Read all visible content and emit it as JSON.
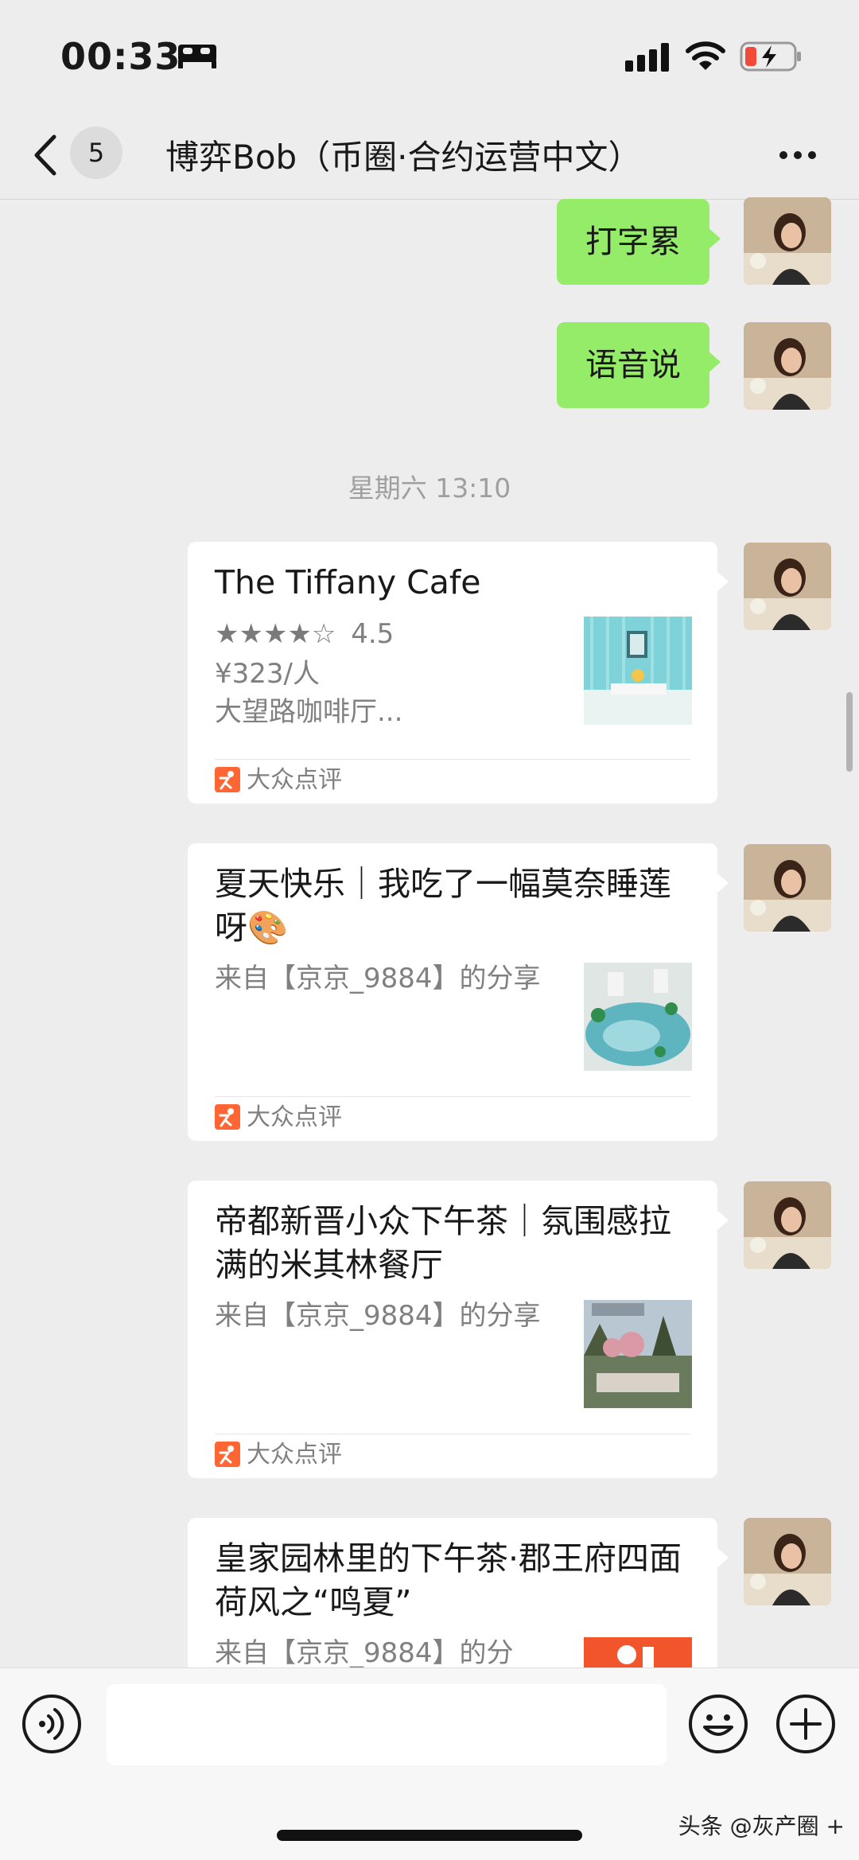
{
  "status_bar": {
    "time": "00:33"
  },
  "nav": {
    "unread_count": "5",
    "title": "博弈Bob（币圈·合约运营中文）"
  },
  "messages": {
    "text_1": "打字累",
    "text_2": "语音说",
    "timestamp": "星期六 13:10",
    "card_1": {
      "title": "The Tiffany Cafe",
      "rating": "4.5",
      "price": "¥323/人",
      "desc": "大望路咖啡厅...",
      "source": "大众点评"
    },
    "card_2": {
      "title": "夏天快乐｜我吃了一幅莫奈睡莲呀🎨",
      "subtitle": "来自【京京_9884】的分享",
      "source": "大众点评"
    },
    "card_3": {
      "title": "帝都新晋小众下午茶｜氛围感拉满的米其林餐厅",
      "subtitle": "来自【京京_9884】的分享",
      "source": "大众点评"
    },
    "card_4": {
      "title": "皇家园林里的下午茶·郡王府四面荷风之“鸣夏”",
      "subtitle": "来自【京京_9884】的分"
    }
  },
  "watermark": "头条 @灰产圈 +",
  "colors": {
    "background": "#ededed",
    "bubble_green": "#95ec69",
    "source_orange": "#ff6633"
  },
  "icons": [
    "sleep-icon",
    "signal-icon",
    "wifi-icon",
    "battery-icon",
    "back-icon",
    "more-icon",
    "voice-icon",
    "emoji-icon",
    "plus-icon",
    "dianping-icon"
  ]
}
